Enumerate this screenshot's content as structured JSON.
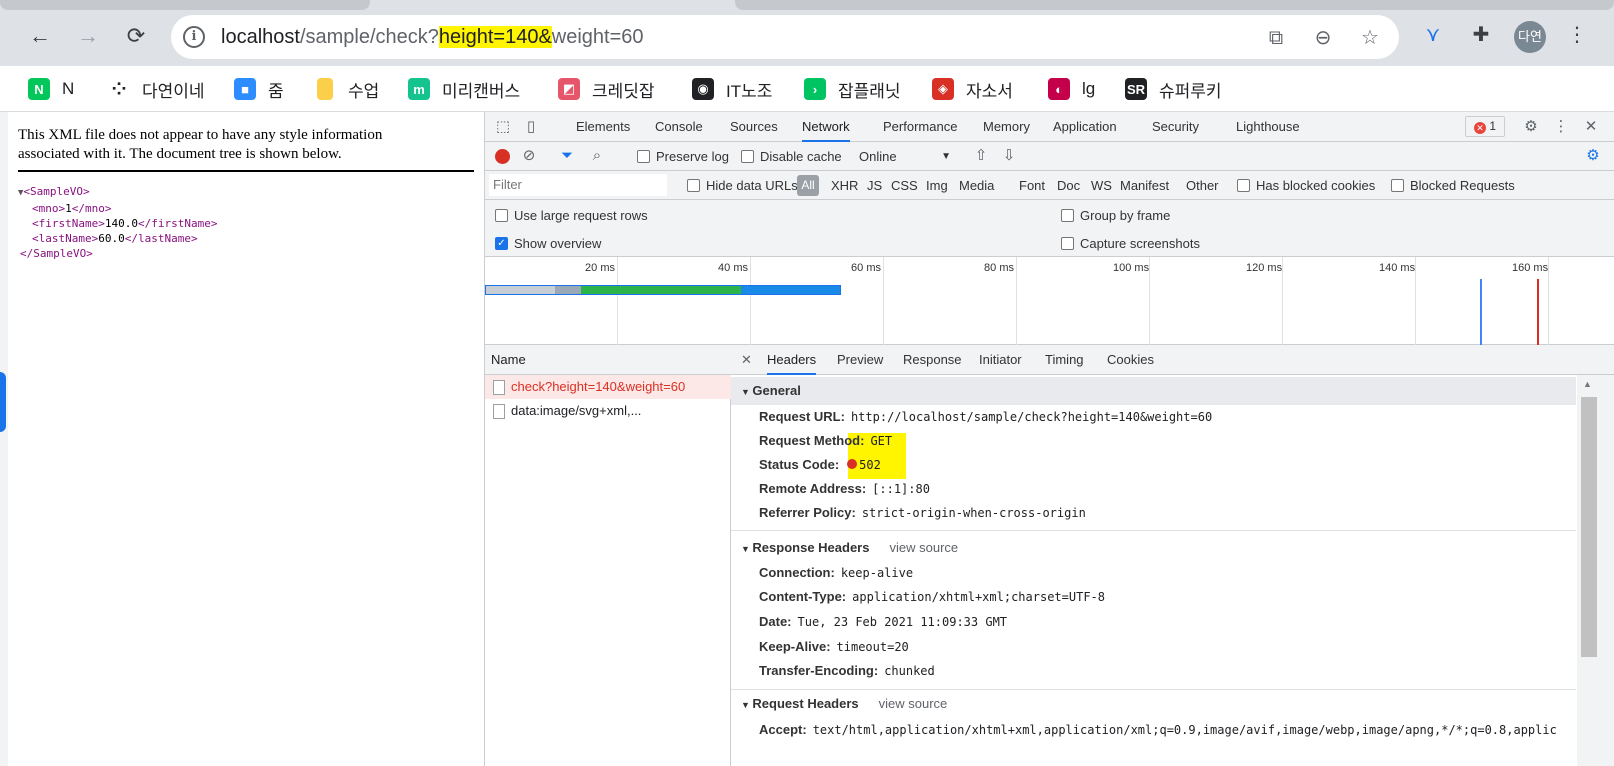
{
  "browser": {
    "url_prefix": "localhost",
    "url_path": "/sample/check?",
    "url_highlight": "height=140&",
    "url_rest": "weight=60",
    "profile": "다연",
    "accent": "#1a73e8"
  },
  "bookmarks": [
    {
      "label": "N",
      "icon": "naver-icon",
      "color": "#03c75a",
      "glyph": "N"
    },
    {
      "label": "다연이네",
      "icon": "dots-icon",
      "color": "#ffffff",
      "glyph": "⁘"
    },
    {
      "label": "줌",
      "icon": "zoom-icon",
      "color": "#2d8cff",
      "glyph": "■"
    },
    {
      "label": "수업",
      "icon": "folder-icon",
      "color": "#fbcf4a",
      "glyph": ""
    },
    {
      "label": "미리캔버스",
      "icon": "miricanvas-icon",
      "color": "#14c38e",
      "glyph": "m"
    },
    {
      "label": "크레딧잡",
      "icon": "kreditjob-icon",
      "color": "#e5566a",
      "glyph": "◩"
    },
    {
      "label": "IT노조",
      "icon": "globe-icon",
      "color": "#202124",
      "glyph": "◉"
    },
    {
      "label": "잡플래닛",
      "icon": "jobplanet-icon",
      "color": "#00c362",
      "glyph": "›"
    },
    {
      "label": "자소서",
      "icon": "jasoseo-icon",
      "color": "#d93025",
      "glyph": "◈"
    },
    {
      "label": "lg",
      "icon": "lg-icon",
      "color": "#c5004a",
      "glyph": "◐"
    },
    {
      "label": "슈퍼루키",
      "icon": "superrookie-icon",
      "color": "#202124",
      "glyph": "SR"
    }
  ],
  "xml": {
    "note_line1": "This XML file does not appear to have any style information",
    "note_line2": "associated with it. The document tree is shown below.",
    "root_open": "<SampleVO>",
    "mno_open": "<mno>",
    "mno_val": "1",
    "mno_close": "</mno>",
    "first_open": "<firstName>",
    "first_val": "140.0",
    "first_close": "</firstName>",
    "last_open": "<lastName>",
    "last_val": "60.0",
    "last_close": "</lastName>",
    "root_close": "</SampleVO>"
  },
  "devtools": {
    "tabs": [
      "Elements",
      "Console",
      "Sources",
      "Network",
      "Performance",
      "Memory",
      "Application",
      "Security",
      "Lighthouse"
    ],
    "active_tab": "Network",
    "error_count": "1",
    "preserve_log": "Preserve log",
    "disable_cache": "Disable cache",
    "throttle": "Online",
    "filter_placeholder": "Filter",
    "hide_data_urls": "Hide data URLs",
    "types": [
      "All",
      "XHR",
      "JS",
      "CSS",
      "Img",
      "Media",
      "Font",
      "Doc",
      "WS",
      "Manifest",
      "Other"
    ],
    "has_blocked_cookies": "Has blocked cookies",
    "blocked_requests": "Blocked Requests",
    "use_large_rows": "Use large request rows",
    "show_overview": "Show overview",
    "group_by_frame": "Group by frame",
    "capture_screenshots": "Capture screenshots",
    "timeline_ticks": [
      "20 ms",
      "40 ms",
      "60 ms",
      "80 ms",
      "100 ms",
      "120 ms",
      "140 ms",
      "160 ms"
    ],
    "name_header": "Name",
    "requests": [
      "check?height=140&weight=60",
      "data:image/svg+xml,..."
    ],
    "detail_tabs": [
      "Headers",
      "Preview",
      "Response",
      "Initiator",
      "Timing",
      "Cookies"
    ],
    "general_title": "General",
    "general": [
      {
        "k": "Request URL:",
        "v": "http://localhost/sample/check?height=140&weight=60"
      },
      {
        "k": "Request Method:",
        "v": "GET"
      },
      {
        "k": "Status Code:",
        "v": "502"
      },
      {
        "k": "Remote Address:",
        "v": "[::1]:80"
      },
      {
        "k": "Referrer Policy:",
        "v": "strict-origin-when-cross-origin"
      }
    ],
    "response_title": "Response Headers",
    "view_source": "view source",
    "response": [
      {
        "k": "Connection:",
        "v": "keep-alive"
      },
      {
        "k": "Content-Type:",
        "v": "application/xhtml+xml;charset=UTF-8"
      },
      {
        "k": "Date:",
        "v": "Tue, 23 Feb 2021 11:09:33 GMT"
      },
      {
        "k": "Keep-Alive:",
        "v": "timeout=20"
      },
      {
        "k": "Transfer-Encoding:",
        "v": "chunked"
      }
    ],
    "request_title": "Request Headers",
    "request": [
      {
        "k": "Accept:",
        "v": "text/html,application/xhtml+xml,application/xml;q=0.9,image/avif,image/webp,image/apng,*/*;q=0.8,applic"
      }
    ]
  }
}
